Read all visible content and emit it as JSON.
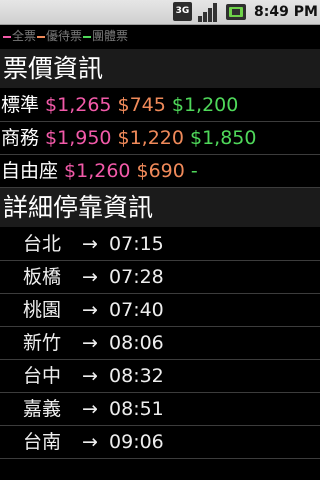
{
  "status_bar": {
    "network": "3G",
    "time": "8:49 PM",
    "icons": [
      "3g-icon",
      "signal-icon",
      "battery-icon"
    ]
  },
  "legend": {
    "items": [
      {
        "label": "全票",
        "color": "#f25aa9"
      },
      {
        "label": "優待票",
        "color": "#f08a5a"
      },
      {
        "label": "團體票",
        "color": "#4fd85a"
      }
    ]
  },
  "fare_section": {
    "title": "票價資訊",
    "rows": [
      {
        "class": "標準",
        "full": "$1,265",
        "concession": "$745",
        "group": "$1,200"
      },
      {
        "class": "商務",
        "full": "$1,950",
        "concession": "$1,220",
        "group": "$1,850"
      },
      {
        "class": "自由座",
        "full": "$1,260",
        "concession": "$690",
        "group": "-"
      }
    ]
  },
  "stops_section": {
    "title": "詳細停靠資訊",
    "arrow": "→",
    "stops": [
      {
        "station": "台北",
        "time": "07:15"
      },
      {
        "station": "板橋",
        "time": "07:28"
      },
      {
        "station": "桃園",
        "time": "07:40"
      },
      {
        "station": "新竹",
        "time": "08:06"
      },
      {
        "station": "台中",
        "time": "08:32"
      },
      {
        "station": "嘉義",
        "time": "08:51"
      },
      {
        "station": "台南",
        "time": "09:06"
      }
    ]
  }
}
